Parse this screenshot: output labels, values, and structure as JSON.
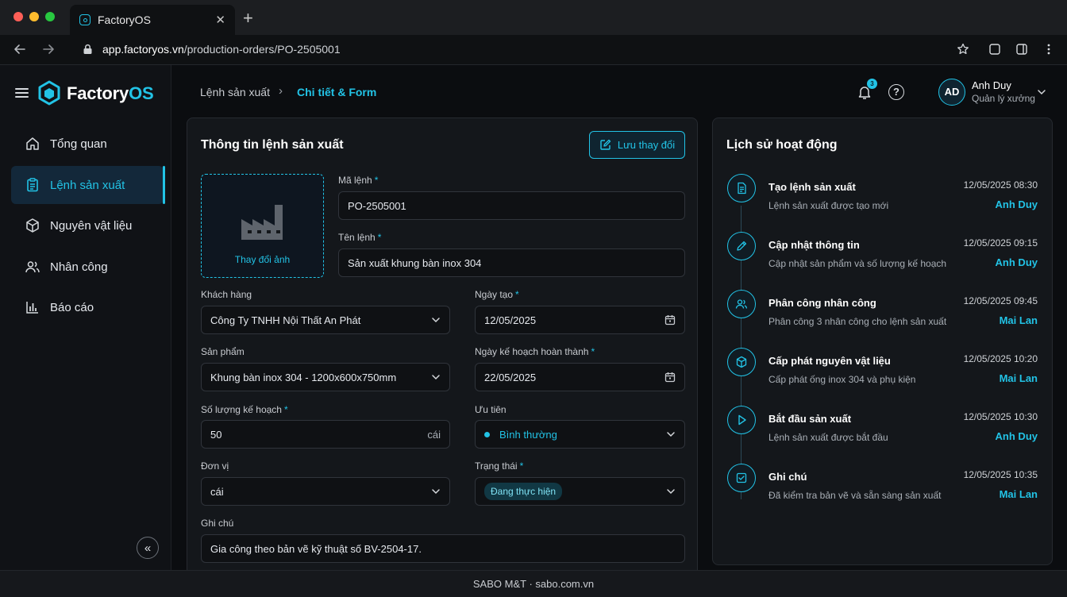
{
  "browser": {
    "tab_title": "FactoryOS",
    "url_host": "app.factoryos.vn",
    "url_path": "/production-orders/PO-2505001"
  },
  "brand": {
    "name_a": "Factory",
    "name_b": "OS"
  },
  "sidebar": {
    "items": [
      {
        "label": "Tổng quan",
        "icon": "home-icon",
        "active": false
      },
      {
        "label": "Lệnh sản xuất",
        "icon": "clipboard-icon",
        "active": true
      },
      {
        "label": "Nguyên vật liệu",
        "icon": "box-icon",
        "active": false
      },
      {
        "label": "Nhân công",
        "icon": "users-icon",
        "active": false
      },
      {
        "label": "Báo cáo",
        "icon": "bar-chart-icon",
        "active": false
      }
    ],
    "collapse_glyph": "«"
  },
  "header": {
    "breadcrumb_parent": "Lệnh sản xuất",
    "breadcrumb_sep": "›",
    "breadcrumb_current": "Chi tiết & Form",
    "notification_count": "3",
    "help_glyph": "?",
    "user_initials": "AD",
    "user_name": "Anh Duy",
    "user_role": "Quản lý xưởng"
  },
  "form": {
    "title": "Thông tin lệnh sản xuất",
    "save_label": "Lưu thay đổi",
    "change_image_label": "Thay đổi ảnh",
    "order_code": {
      "label": "Mã lệnh",
      "value": "PO-2505001"
    },
    "order_name": {
      "label": "Tên lệnh",
      "value": "Sản xuất khung bàn inox 304"
    },
    "customer": {
      "label": "Khách hàng",
      "value": "Công Ty TNHH Nội Thất An Phát"
    },
    "created_date": {
      "label": "Ngày tạo",
      "value": "12/05/2025"
    },
    "product": {
      "label": "Sản phẩm",
      "value": "Khung bàn inox 304 - 1200x600x750mm"
    },
    "planned_date": {
      "label": "Ngày kế hoạch hoàn thành",
      "value": "22/05/2025"
    },
    "planned_qty": {
      "label": "Số lượng kế hoạch",
      "value": "50",
      "suffix": "cái"
    },
    "priority": {
      "label": "Ưu tiên",
      "value": "Bình thường"
    },
    "unit": {
      "label": "Đơn vị",
      "value": "cái"
    },
    "status": {
      "label": "Trạng thái",
      "value": "Đang thực hiện"
    },
    "note": {
      "label": "Ghi chú",
      "value": "Gia công theo bản vẽ kỹ thuật số BV-2504-17."
    }
  },
  "history": {
    "title": "Lịch sử hoạt động",
    "items": [
      {
        "icon": "document-icon",
        "title": "Tạo lệnh sản xuất",
        "desc": "Lệnh sản xuất được tạo mới",
        "time": "12/05/2025 08:30",
        "user": "Anh Duy"
      },
      {
        "icon": "pencil-icon",
        "title": "Cập nhật thông tin",
        "desc": "Cập nhật sản phẩm và số lượng kế hoạch",
        "time": "12/05/2025 09:15",
        "user": "Anh Duy"
      },
      {
        "icon": "users-icon",
        "title": "Phân công nhân công",
        "desc": "Phân công 3 nhân công cho lệnh sản xuất",
        "time": "12/05/2025 09:45",
        "user": "Mai Lan"
      },
      {
        "icon": "cube-icon",
        "title": "Cấp phát nguyên vật liệu",
        "desc": "Cấp phát ống inox 304 và phụ kiện",
        "time": "12/05/2025 10:20",
        "user": "Mai Lan"
      },
      {
        "icon": "play-icon",
        "title": "Bắt đầu sản xuất",
        "desc": "Lệnh sản xuất được bắt đầu",
        "time": "12/05/2025 10:30",
        "user": "Anh Duy"
      },
      {
        "icon": "note-check-icon",
        "title": "Ghi chú",
        "desc": "Đã kiểm tra bản vẽ và sẵn sàng sản xuất",
        "time": "12/05/2025 10:35",
        "user": "Mai Lan"
      }
    ]
  },
  "footer": {
    "text": "SABO M&T · sabo.com.vn"
  },
  "colors": {
    "accent": "#22c3e6",
    "background": "#0b0d10",
    "card": "#14171b"
  }
}
